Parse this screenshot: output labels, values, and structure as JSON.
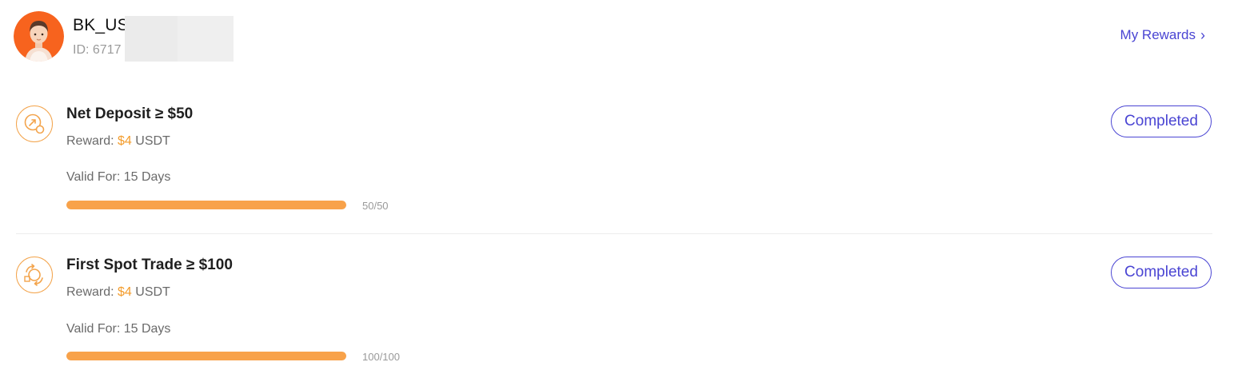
{
  "user": {
    "name": "BK_US",
    "id_label": "ID: 6717"
  },
  "header": {
    "my_rewards_label": "My Rewards",
    "my_rewards_chevron": "›"
  },
  "tasks": [
    {
      "title": "Net Deposit ≥ $50",
      "reward_prefix": "Reward: ",
      "reward_amount": "$4",
      "reward_suffix": " USDT",
      "valid_for": "Valid For: 15 Days",
      "progress_text": "50/50",
      "progress_fraction": 1.0,
      "status": "Completed",
      "icon": "deposit-icon"
    },
    {
      "title": "First Spot Trade ≥ $100",
      "reward_prefix": "Reward: ",
      "reward_amount": "$4",
      "reward_suffix": " USDT",
      "valid_for": "Valid For: 15 Days",
      "progress_text": "100/100",
      "progress_fraction": 1.0,
      "status": "Completed",
      "icon": "spot-trade-icon"
    }
  ],
  "colors": {
    "accent": "#4a45d3",
    "reward_orange": "#f39c2c",
    "progress_fill": "#f8a24a",
    "avatar_bg": "#f7631e"
  }
}
